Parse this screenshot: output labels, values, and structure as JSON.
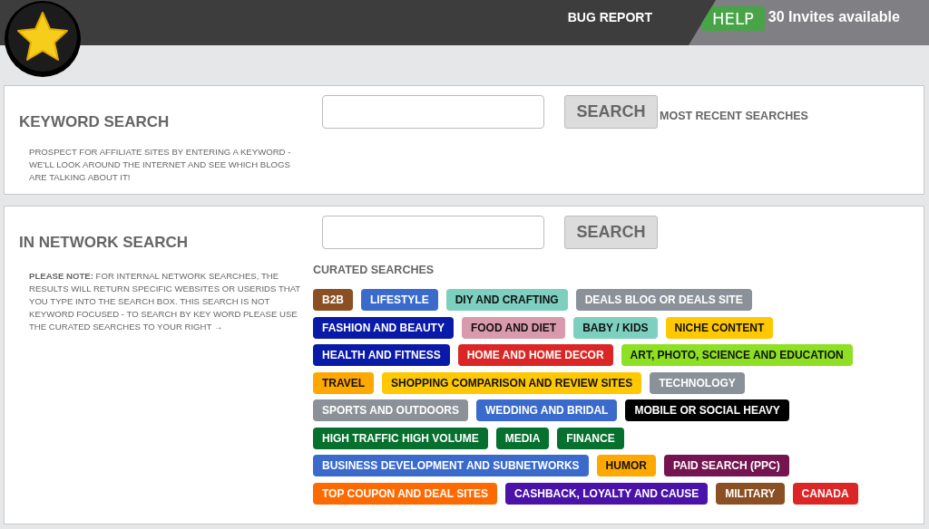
{
  "header": {
    "links": [
      "BUG REPORT"
    ],
    "help_button": "HELP",
    "invites": "30 Invites available"
  },
  "keyword_search": {
    "title": "KEYWORD SEARCH",
    "description": "PROSPECT FOR AFFILIATE SITES BY ENTERING A KEYWORD - WE'LL LOOK AROUND THE INTERNET AND SEE WHICH BLOGS ARE TALKING ABOUT IT!",
    "button": "SEARCH",
    "recent_title": "MOST RECENT SEARCHES"
  },
  "network_search": {
    "title": "IN NETWORK SEARCH",
    "description": "**PLEASE NOTE:** FOR INTERNAL NETWORK SEARCHES, THE RESULTS WILL RETURN SPECIFIC WEBSITES OR USERIDS THAT YOU TYPE INTO THE SEARCH BOX. THIS SEARCH IS NOT KEYWORD FOCUSED - TO SEARCH BY KEY WORD PLEASE USE THE CURATED SEARCHES TO YOUR RIGHT →",
    "button": "SEARCH",
    "curated_title": "CURATED SEARCHES",
    "tags": [
      [
        {
          "label": "B2B",
          "color": "#8b4f24"
        },
        {
          "label": "LIFESTYLE",
          "color": "#3a6bcc"
        },
        {
          "label": "DIY AND CRAFTING",
          "color": "#7dcfc0"
        },
        {
          "label": "DEALS BLOG OR DEALS SITE",
          "color": "#8a9199"
        }
      ],
      [
        {
          "label": "FASHION AND BEAUTY",
          "color": "#0a1aa8"
        },
        {
          "label": "FOOD AND DIET",
          "color": "#d99aae"
        },
        {
          "label": "BABY / KIDS",
          "color": "#7dcfc0"
        },
        {
          "label": "NICHE CONTENT",
          "color": "#ffc800"
        }
      ],
      [
        {
          "label": "HEALTH AND FITNESS",
          "color": "#0a1aa8"
        },
        {
          "label": "HOME AND HOME DECOR",
          "color": "#dc2626"
        },
        {
          "label": "ART, PHOTO, SCIENCE AND EDUCATION",
          "color": "#8ee022"
        }
      ],
      [
        {
          "label": "TRAVEL",
          "color": "#ffa800"
        },
        {
          "label": "SHOPPING COMPARISON AND REVIEW SITES",
          "color": "#ffc800"
        },
        {
          "label": "TECHNOLOGY",
          "color": "#8a9199"
        }
      ],
      [
        {
          "label": "SPORTS AND OUTDOORS",
          "color": "#8a9199"
        },
        {
          "label": "WEDDING AND BRIDAL",
          "color": "#3a6bcc"
        },
        {
          "label": "MOBILE OR SOCIAL HEAVY",
          "color": "#000000"
        }
      ],
      [
        {
          "label": "HIGH TRAFFIC HIGH VOLUME",
          "color": "#06702e"
        },
        {
          "label": "MEDIA",
          "color": "#06702e"
        },
        {
          "label": "FINANCE",
          "color": "#06702e"
        }
      ],
      [
        {
          "label": "BUSINESS DEVELOPMENT AND SUBNETWORKS",
          "color": "#3a6bcc"
        },
        {
          "label": "HUMOR",
          "color": "#ffa800"
        },
        {
          "label": "PAID SEARCH (PPC)",
          "color": "#741451"
        }
      ],
      [
        {
          "label": "TOP COUPON AND DEAL SITES",
          "color": "#ff6a00"
        },
        {
          "label": "CASHBACK, LOYALTY AND CAUSE",
          "color": "#4a12a8"
        },
        {
          "label": "MILITARY",
          "color": "#8b4f24"
        },
        {
          "label": "CANADA",
          "color": "#dc2626"
        }
      ]
    ]
  }
}
